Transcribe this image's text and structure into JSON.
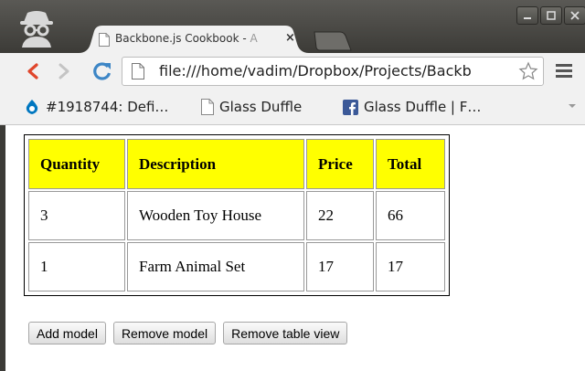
{
  "browser": {
    "tab_title_main": "Backbone.js Cookbook - ",
    "tab_title_faded": "A",
    "tab_close": "×",
    "url": "file:///home/vadim/Dropbox/Projects/Backb"
  },
  "bookmarks": [
    {
      "label": "#1918744: Defi…",
      "icon": "drupal-icon"
    },
    {
      "label": "Glass Duffle",
      "icon": "page-icon"
    },
    {
      "label": "Glass Duffle | F…",
      "icon": "facebook-icon"
    }
  ],
  "table": {
    "headers": [
      "Quantity",
      "Description",
      "Price",
      "Total"
    ],
    "rows": [
      [
        "3",
        "Wooden Toy House",
        "22",
        "66"
      ],
      [
        "1",
        "Farm Animal Set",
        "17",
        "17"
      ]
    ]
  },
  "buttons": {
    "add": "Add model",
    "remove": "Remove model",
    "remove_table": "Remove table view"
  },
  "colors": {
    "header_bg": "#ffff00",
    "titlebar": "#3c3b37",
    "back_arrow": "#e0462c",
    "reload": "#3d86c6"
  }
}
